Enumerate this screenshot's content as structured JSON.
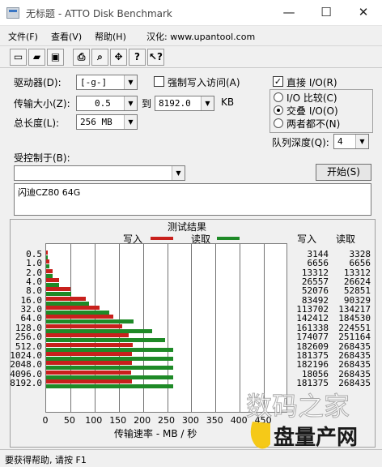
{
  "window": {
    "title": "无标题 - ATTO Disk Benchmark"
  },
  "menu": [
    "文件(F)",
    "查看(V)",
    "帮助(H)",
    "汉化: www.upantool.com"
  ],
  "toolbar": [
    "new-icon",
    "open-icon",
    "save-icon",
    "print-icon",
    "print-preview-icon",
    "move-icon",
    "help-icon",
    "context-help-icon"
  ],
  "settings": {
    "drive_label": "驱动器(D):",
    "drive_value": "[-g-]",
    "force_write_label": "强制写入访问(A)",
    "force_write_checked": false,
    "transfer_label": "传输大小(Z):",
    "transfer_from": "0.5",
    "to_label": "到",
    "transfer_to": "8192.0",
    "kb_label": "KB",
    "length_label": "总长度(L):",
    "length_value": "256 MB",
    "direct_io_label": "直接 I/O(R)",
    "direct_io_checked": true,
    "radio_io_compare": "I/O 比较(C)",
    "radio_overlap": "交叠 I/O(O)",
    "radio_neither": "两者都不(N)",
    "selected_radio": "交叠 I/O(O)",
    "queue_label": "队列深度(Q):",
    "queue_value": "4",
    "controlled_by_label": "受控制于(B):",
    "controlled_by_value": "",
    "start_button": "开始(S)",
    "description": "闪迪CZ80 64G"
  },
  "results": {
    "title": "测试结果",
    "write_legend": "写入",
    "read_legend": "读取",
    "write_col": "写入",
    "read_col": "读取",
    "x_axis_label": "传输速率 - MB / 秒",
    "write_color": "#c8201c",
    "read_color": "#1e8a27"
  },
  "chart_data": {
    "type": "bar",
    "orientation": "horizontal",
    "title": "测试结果",
    "xlabel": "传输速率 - MB / 秒",
    "ylabel": "",
    "xlim": [
      0,
      500
    ],
    "x_ticks": [
      "0",
      "50",
      "100",
      "150",
      "200",
      "250",
      "300",
      "350",
      "400",
      "450"
    ],
    "categories": [
      "0.5",
      "1.0",
      "2.0",
      "4.0",
      "8.0",
      "16.0",
      "32.0",
      "64.0",
      "128.0",
      "256.0",
      "512.0",
      "1024.0",
      "2048.0",
      "4096.0",
      "8192.0"
    ],
    "series": [
      {
        "name": "写入",
        "values": [
          3144,
          6656,
          13312,
          26557,
          52076,
          83492,
          113702,
          142412,
          161338,
          174077,
          182609,
          181375,
          182196,
          180561,
          181375
        ]
      },
      {
        "name": "读取",
        "values": [
          3328,
          6656,
          13312,
          26624,
          52851,
          90329,
          134217,
          184530,
          224551,
          251164,
          268435,
          268435,
          268435,
          268435,
          268435
        ]
      }
    ],
    "write_display": [
      "3144",
      "6656",
      "13312",
      "26557",
      "52076",
      "83492",
      "113702",
      "142412",
      "161338",
      "174077",
      "182609",
      "181375",
      "182196",
      "18056",
      "181375"
    ],
    "read_display": [
      "3328",
      "6656",
      "13312",
      "26624",
      "52851",
      "90329",
      "134217",
      "184530",
      "224551",
      "251164",
      "268435",
      "268435",
      "268435",
      "268435",
      "268435"
    ]
  },
  "status": {
    "text": "要获得帮助, 请按 F1"
  },
  "watermark": {
    "line1": "数码之家",
    "line2": "U盘量产网",
    "url": "WWW.UPANTOOL.COM"
  }
}
